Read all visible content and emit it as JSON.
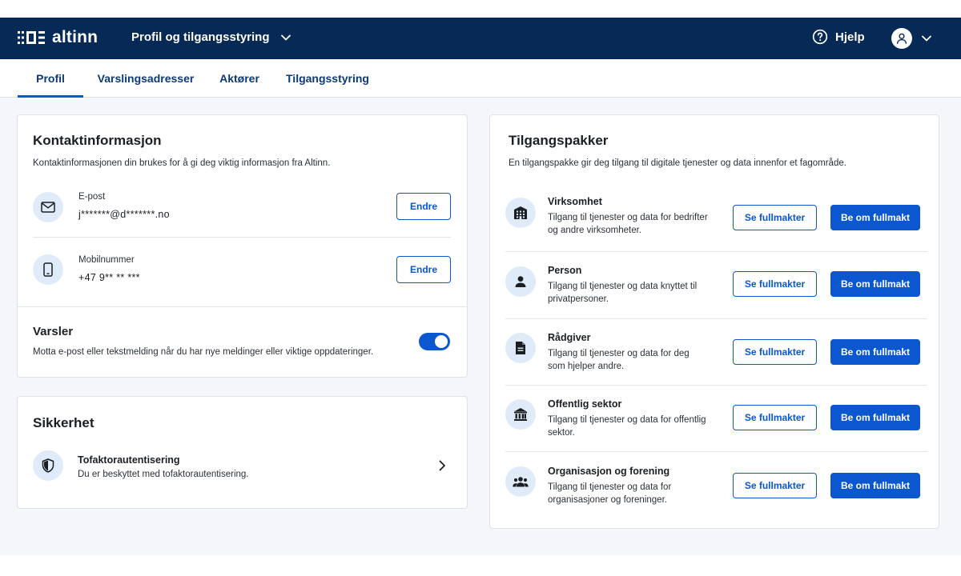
{
  "header": {
    "logo_text": "altinn",
    "app_title": "Profil og tilgangsstyring",
    "help_label": "Hjelp"
  },
  "tabs": [
    {
      "label": "Profil",
      "active": true
    },
    {
      "label": "Varslingsadresser",
      "active": false
    },
    {
      "label": "Aktører",
      "active": false
    },
    {
      "label": "Tilgangsstyring",
      "active": false
    }
  ],
  "contact": {
    "title": "Kontaktinformasjon",
    "description": "Kontaktinformasjonen din brukes for å gi deg viktig informasjon fra Altinn.",
    "email": {
      "label": "E-post",
      "value": "j*******@d*******.no",
      "button": "Endre",
      "icon": "mail-icon"
    },
    "phone": {
      "label": "Mobilnummer",
      "value": "+47 9** ** ***",
      "button": "Endre",
      "icon": "phone-icon"
    }
  },
  "notifications": {
    "title": "Varsler",
    "description": "Motta e-post eller tekstmelding når du har nye meldinger eller viktige oppdateringer.",
    "enabled": true
  },
  "security": {
    "title": "Sikkerhet",
    "item_title": "Tofaktorautentisering",
    "item_description": "Du er beskyttet med tofaktorautentisering.",
    "icon": "shield-icon"
  },
  "packages": {
    "title": "Tilgangspakker",
    "description": "En tilgangspakke gir deg tilgang til digitale tjenester og data innenfor et fagområde.",
    "see_label": "Se fullmakter",
    "request_label": "Be om fullmakt",
    "items": [
      {
        "name": "Virksomhet",
        "desc": "Tilgang til tjenester og data for bedrifter og andre virksomheter.",
        "icon": "building-icon"
      },
      {
        "name": "Person",
        "desc": "Tilgang til tjenester og data knyttet til privatpersoner.",
        "icon": "person-icon"
      },
      {
        "name": "Rådgiver",
        "desc": "Tilgang til tjenester og data for deg som hjelper andre.",
        "icon": "document-icon"
      },
      {
        "name": "Offentlig sektor",
        "desc": "Tilgang til tjenester og data for offentlig sektor.",
        "icon": "government-icon"
      },
      {
        "name": "Organisasjon og forening",
        "desc": "Tilgang til tjenester og data for organisasjoner og foreninger.",
        "icon": "group-icon"
      }
    ]
  },
  "colors": {
    "header_bg": "#072956",
    "primary": "#0b57d0",
    "icon_circle": "#dfebf8",
    "page_bg": "#f4f6f9"
  }
}
